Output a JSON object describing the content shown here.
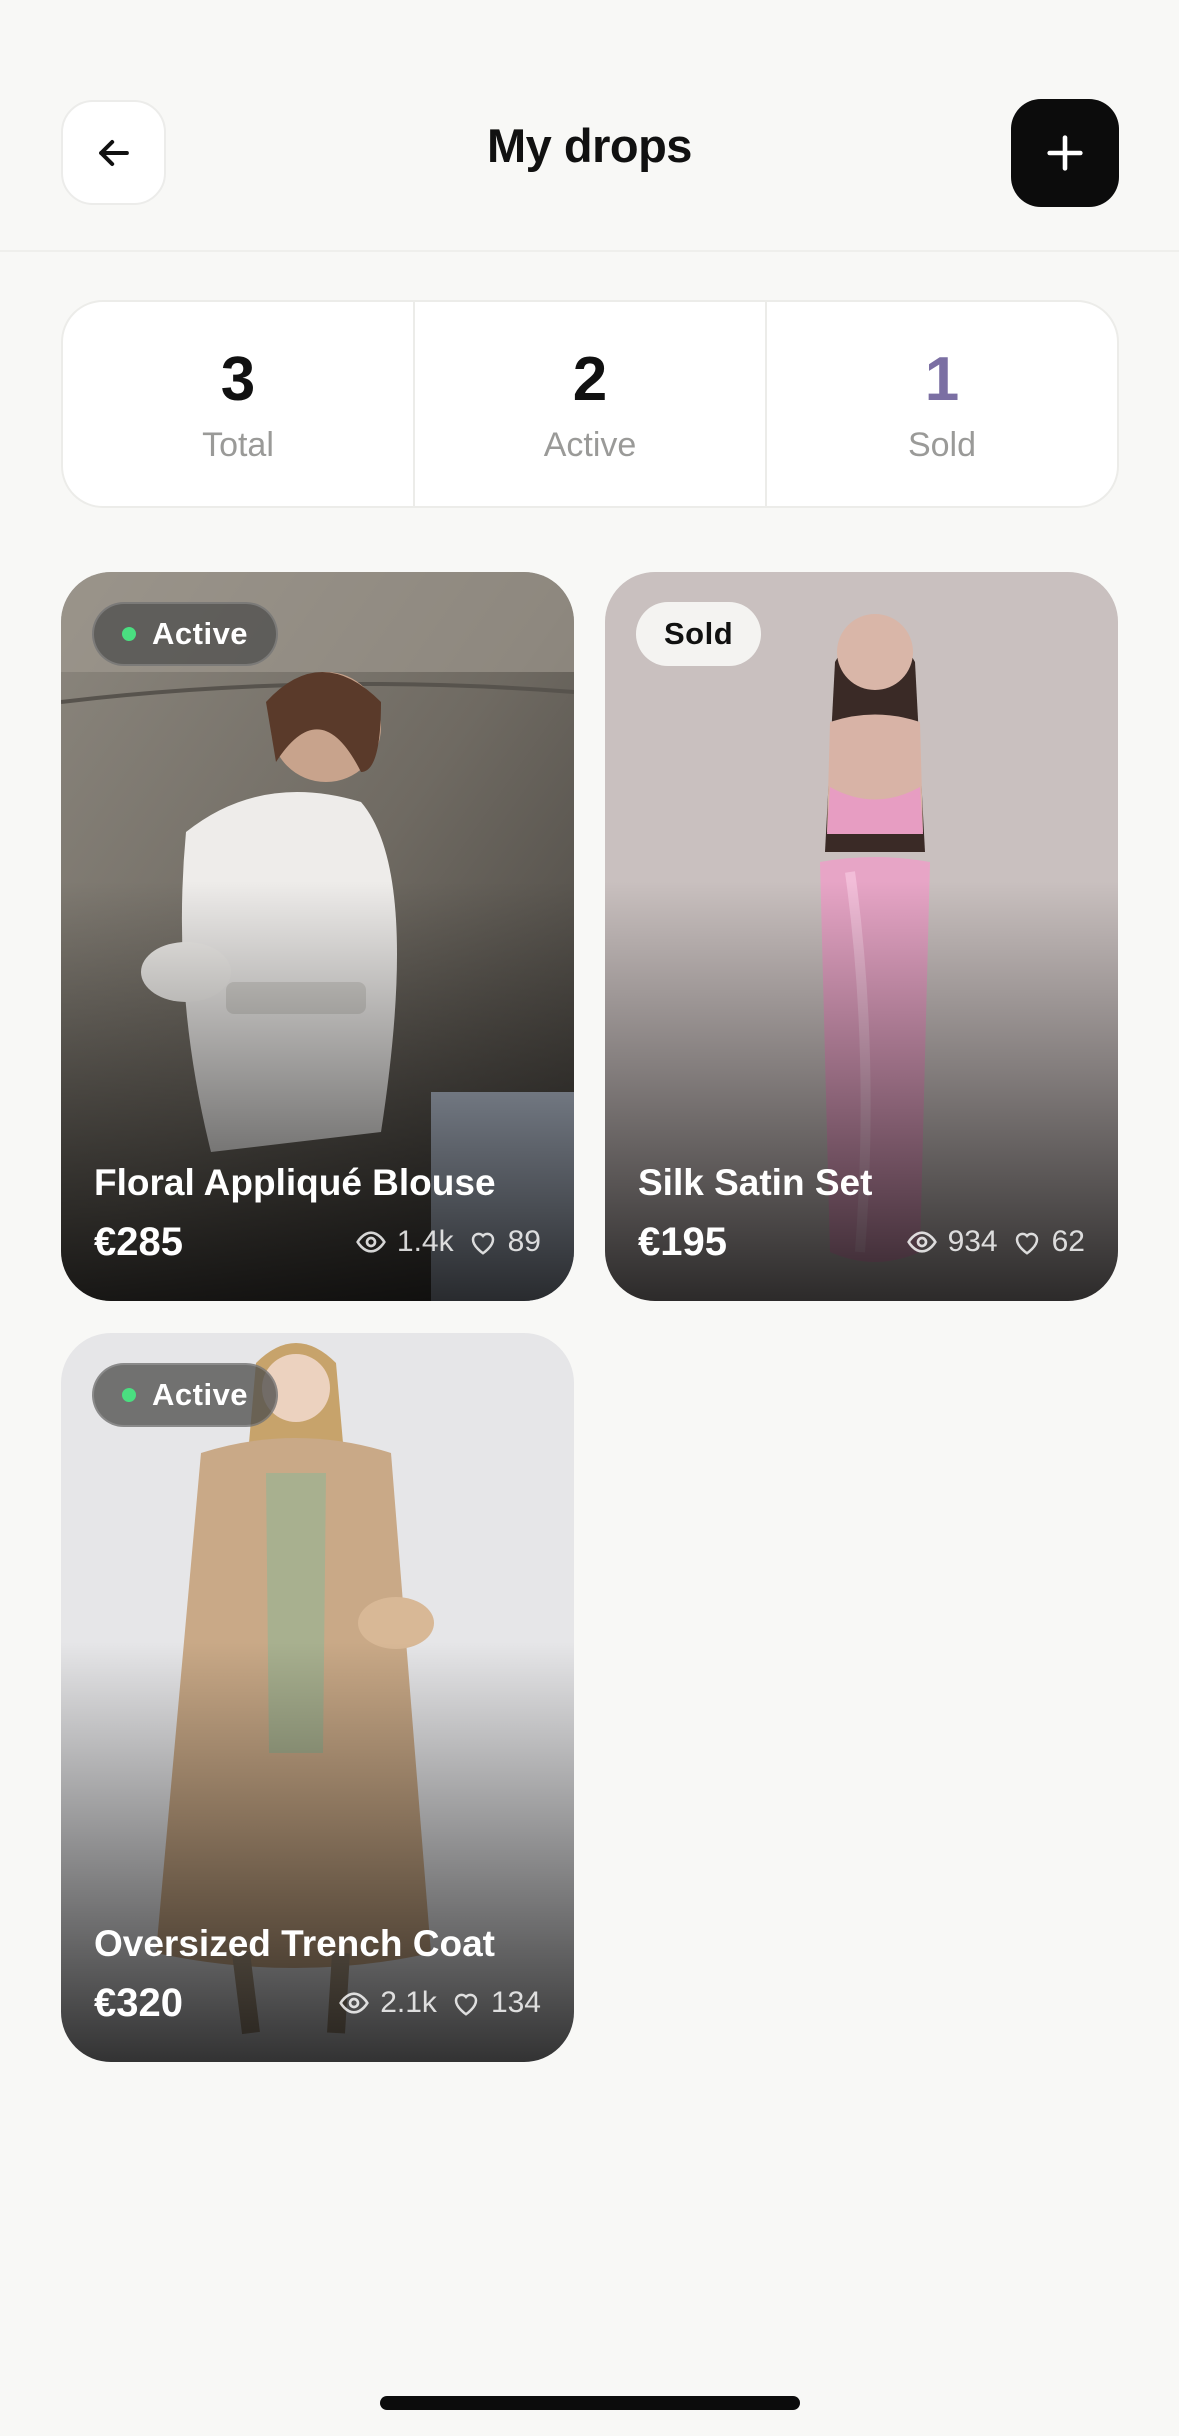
{
  "header": {
    "title": "My drops",
    "back_icon": "arrow-left-icon",
    "add_icon": "plus-icon"
  },
  "stats": [
    {
      "value": "3",
      "label": "Total",
      "color": "#111111"
    },
    {
      "value": "2",
      "label": "Active",
      "color": "#111111"
    },
    {
      "value": "1",
      "label": "Sold",
      "color": "#7b6fa3"
    }
  ],
  "drops": [
    {
      "status": "Active",
      "title": "Floral Appliqué Blouse",
      "price": "€285",
      "views": "1.4k",
      "likes": "89"
    },
    {
      "status": "Sold",
      "title": "Silk Satin Set",
      "price": "€195",
      "views": "934",
      "likes": "62"
    },
    {
      "status": "Active",
      "title": "Oversized Trench Coat",
      "price": "€320",
      "views": "2.1k",
      "likes": "134"
    }
  ],
  "colors": {
    "background": "#f8f8f6",
    "active_dot": "#4ade80",
    "primary_button": "#0c0c0c"
  }
}
